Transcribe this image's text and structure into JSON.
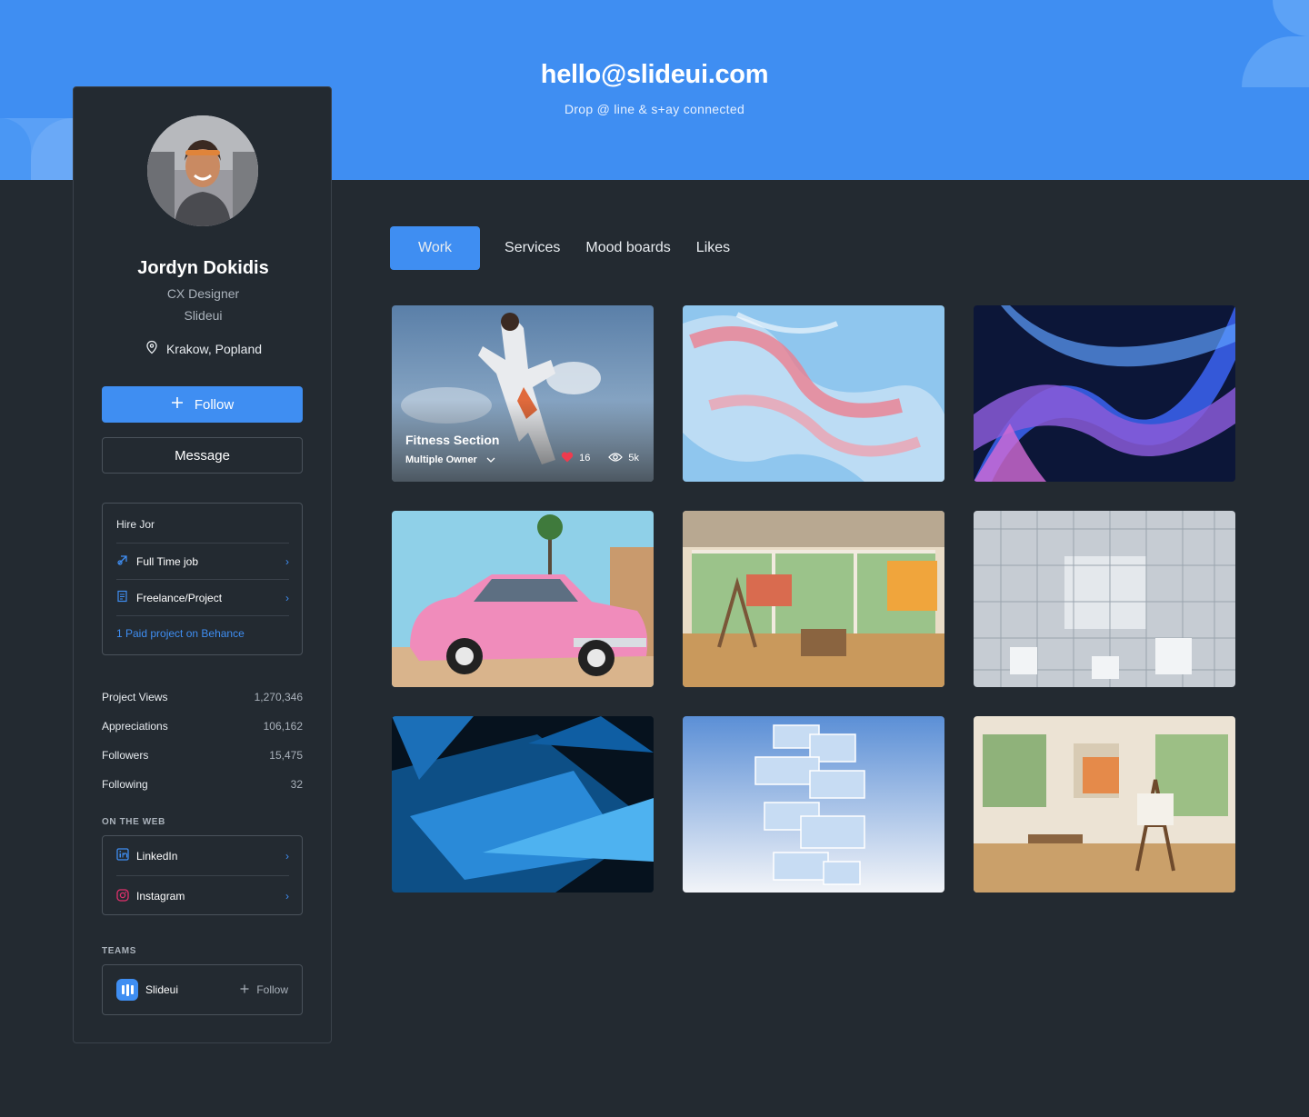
{
  "banner": {
    "email": "hello@slideui.com",
    "tagline": "Drop @ line & s+ay connected"
  },
  "profile": {
    "name": "Jordyn Dokidis",
    "role": "CX Designer",
    "company": "Slideui",
    "location": "Krakow, Popland",
    "follow_label": "Follow",
    "message_label": "Message"
  },
  "hire": {
    "title": "Hire Jor",
    "items": [
      {
        "label": "Full Time job"
      },
      {
        "label": "Freelance/Project"
      }
    ],
    "link": "1 Paid project on Behance"
  },
  "stats": [
    {
      "label": "Project Views",
      "value": "1,270,346"
    },
    {
      "label": "Appreciations",
      "value": "106,162"
    },
    {
      "label": "Followers",
      "value": "15,475"
    },
    {
      "label": "Following",
      "value": "32"
    }
  ],
  "web": {
    "title": "ON THE WEB",
    "items": [
      {
        "label": "LinkedIn"
      },
      {
        "label": "Instagram"
      }
    ]
  },
  "teams": {
    "title": "TEAMS",
    "name": "Slideui",
    "follow_label": "Follow"
  },
  "tabs": [
    {
      "label": "Work",
      "active": true
    },
    {
      "label": "Services"
    },
    {
      "label": "Mood boards"
    },
    {
      "label": "Likes"
    }
  ],
  "featured": {
    "title": "Fitness Section",
    "owner": "Multiple Owner",
    "likes": "16",
    "views": "5k"
  },
  "colors": {
    "accent": "#3f8ef2",
    "background": "#232a31",
    "heart": "#ef3b4e"
  }
}
